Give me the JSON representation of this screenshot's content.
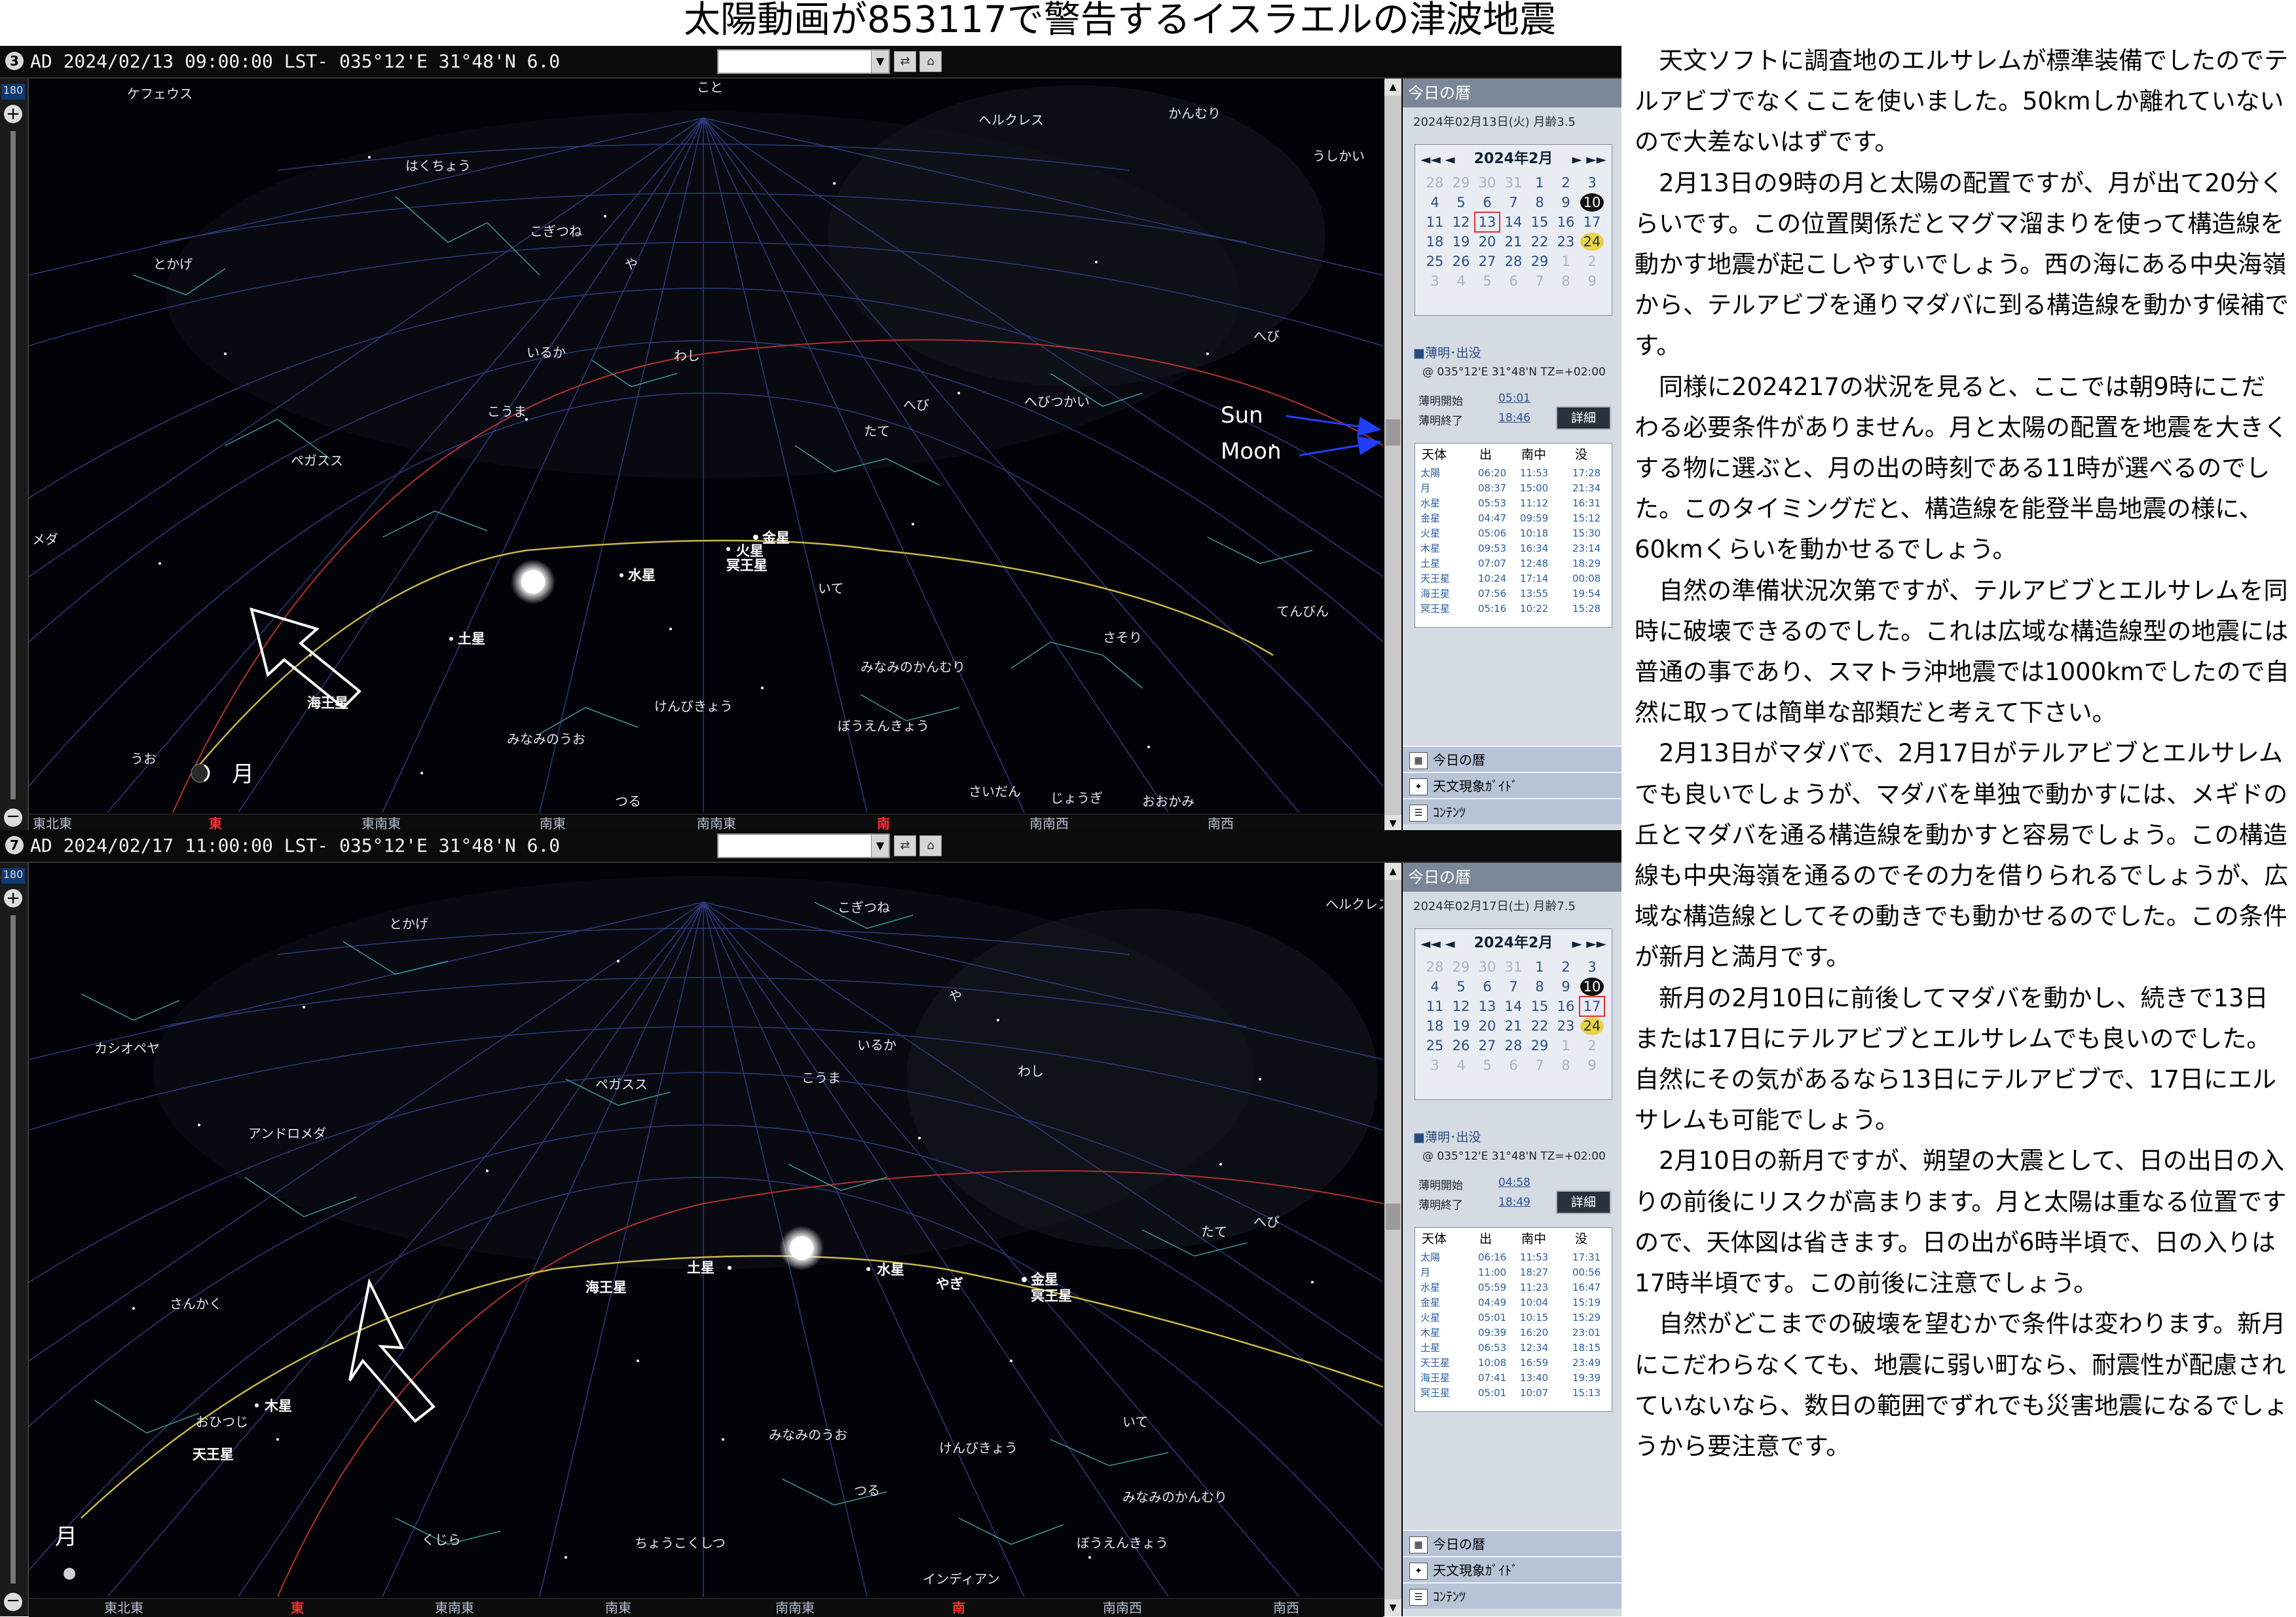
{
  "title": "太陽動画が853117で警告するイスラエルの津波地震",
  "windows": [
    {
      "window_number": "3",
      "status": "AD 2024/02/13 09:00:00 LST- 035°12'E 31°48'N 6.0",
      "slider_value": "180",
      "directions": [
        "東北東",
        "東",
        "東南東",
        "南東",
        "南南東",
        "南",
        "南南西",
        "南西"
      ],
      "main_direction": "東",
      "south": "南",
      "constellations": [
        "ケフェウス",
        "こと",
        "ヘルクレス",
        "かんむり",
        "はくちょう",
        "うしかい",
        "こぎつね",
        "とかげ",
        "や",
        "へび",
        "いるか",
        "わし",
        "へびつかい",
        "こうま",
        "へび",
        "たて",
        "ペガスス",
        "メダ",
        "いて",
        "さそり",
        "てんびん",
        "みなみのかんむり",
        "けんびきょう",
        "ぼうえんきょう",
        "みなみのうお",
        "うお",
        "つる",
        "さいだん",
        "じょうぎ",
        "おおかみ"
      ],
      "planets": [
        "金星",
        "火星",
        "冥王星",
        "水星",
        "土星",
        "海王星",
        "月"
      ],
      "annotations": [
        "Sun",
        "Moon"
      ],
      "today_title": "今日の暦",
      "today_date": "2024年02月13日(火)  月齢3.5",
      "calendar": {
        "month": "2024年2月",
        "nav_left": "◄◄ ◄",
        "nav_right": "► ►►",
        "days": [
          "28",
          "29",
          "30",
          "31",
          "1",
          "2",
          "3",
          "4",
          "5",
          "6",
          "7",
          "8",
          "9",
          "10",
          "11",
          "12",
          "13",
          "14",
          "15",
          "16",
          "17",
          "18",
          "19",
          "20",
          "21",
          "22",
          "23",
          "24",
          "25",
          "26",
          "27",
          "28",
          "29",
          "1",
          "2",
          "3",
          "4",
          "5",
          "6",
          "7",
          "8",
          "9"
        ],
        "selected": "13"
      },
      "twilight_section": "■薄明･出没",
      "location": "@ 035°12'E 31°48'N TZ=+02:00",
      "twilight_start_label": "薄明開始",
      "twilight_start": "05:01",
      "twilight_end_label": "薄明終了",
      "twilight_end": "18:46",
      "detail_button": "詳細",
      "table_headers": [
        "天体",
        "出",
        "南中",
        "没"
      ],
      "table_rows": [
        [
          "太陽",
          "06:20",
          "11:53",
          "17:28"
        ],
        [
          "月",
          "08:37",
          "15:00",
          "21:34"
        ],
        [
          "水星",
          "05:53",
          "11:12",
          "16:31"
        ],
        [
          "金星",
          "04:47",
          "09:59",
          "15:12"
        ],
        [
          "火星",
          "05:06",
          "10:18",
          "15:30"
        ],
        [
          "木星",
          "09:53",
          "16:34",
          "23:14"
        ],
        [
          "土星",
          "07:07",
          "12:48",
          "18:29"
        ],
        [
          "天王星",
          "10:24",
          "17:14",
          "00:08"
        ],
        [
          "海王星",
          "07:56",
          "13:55",
          "19:54"
        ],
        [
          "冥王星",
          "05:16",
          "10:22",
          "15:28"
        ]
      ],
      "buttons": [
        "今日の暦",
        "天文現象ｶﾞｲﾄﾞ",
        "ｺﾝﾃﾝﾂ"
      ]
    },
    {
      "window_number": "7",
      "status": "AD 2024/02/17 11:00:00 LST- 035°12'E 31°48'N 6.0",
      "slider_value": "180",
      "directions": [
        "東北東",
        "東",
        "東南東",
        "南東",
        "南南東",
        "南",
        "南南西",
        "南西"
      ],
      "main_direction": "東",
      "south": "南",
      "constellations": [
        "とかげ",
        "こぎつね",
        "ヘルクレス",
        "や",
        "カシオペヤ",
        "いるか",
        "ペガスス",
        "こうま",
        "わし",
        "アンドロメダ",
        "たて",
        "へび",
        "さんかく",
        "いて",
        "おひつじ",
        "みなみのうお",
        "けんびきょう",
        "つる",
        "みなみのかんむり",
        "くじら",
        "ちょうこくしつ",
        "ぼうえんきょう",
        "インディアン"
      ],
      "planets": [
        "海王星",
        "土星",
        "水星",
        "やぎ",
        "金星",
        "冥王星",
        "木星",
        "天王星",
        "月"
      ],
      "today_title": "今日の暦",
      "today_date": "2024年02月17日(土)  月齢7.5",
      "calendar": {
        "month": "2024年2月",
        "nav_left": "◄◄ ◄",
        "nav_right": "► ►►",
        "days": [
          "28",
          "29",
          "30",
          "31",
          "1",
          "2",
          "3",
          "4",
          "5",
          "6",
          "7",
          "8",
          "9",
          "10",
          "11",
          "12",
          "13",
          "14",
          "15",
          "16",
          "17",
          "18",
          "19",
          "20",
          "21",
          "22",
          "23",
          "24",
          "25",
          "26",
          "27",
          "28",
          "29",
          "1",
          "2",
          "3",
          "4",
          "5",
          "6",
          "7",
          "8",
          "9"
        ],
        "selected": "17"
      },
      "twilight_section": "■薄明･出没",
      "location": "@ 035°12'E 31°48'N TZ=+02:00",
      "twilight_start_label": "薄明開始",
      "twilight_start": "04:58",
      "twilight_end_label": "薄明終了",
      "twilight_end": "18:49",
      "detail_button": "詳細",
      "table_headers": [
        "天体",
        "出",
        "南中",
        "没"
      ],
      "table_rows": [
        [
          "太陽",
          "06:16",
          "11:53",
          "17:31"
        ],
        [
          "月",
          "11:00",
          "18:27",
          "00:56"
        ],
        [
          "水星",
          "05:59",
          "11:23",
          "16:47"
        ],
        [
          "金星",
          "04:49",
          "10:04",
          "15:19"
        ],
        [
          "火星",
          "05:01",
          "10:15",
          "15:29"
        ],
        [
          "木星",
          "09:39",
          "16:20",
          "23:01"
        ],
        [
          "土星",
          "06:53",
          "12:34",
          "18:15"
        ],
        [
          "天王星",
          "10:08",
          "16:59",
          "23:49"
        ],
        [
          "海王星",
          "07:41",
          "13:40",
          "19:39"
        ],
        [
          "冥王星",
          "05:01",
          "10:07",
          "15:13"
        ]
      ],
      "buttons": [
        "今日の暦",
        "天文現象ｶﾞｲﾄﾞ",
        "ｺﾝﾃﾝﾂ"
      ]
    }
  ],
  "paragraphs": [
    "　天文ソフトに調査地のエルサレムが標準装備でしたのでテルアビブでなくここを使いました。50kmしか離れていないので大差ないはずです。",
    "　2月13日の9時の月と太陽の配置ですが、月が出て20分くらいです。この位置関係だとマグマ溜まりを使って構造線を動かす地震が起こしやすいでしょう。西の海にある中央海嶺から、テルアビブを通りマダバに到る構造線を動かす候補です。",
    "　同様に2024217の状況を見ると、ここでは朝9時にこだわる必要条件がありません。月と太陽の配置を地震を大きくする物に選ぶと、月の出の時刻である11時が選べるのでした。このタイミングだと、構造線を能登半島地震の様に、60kmくらいを動かせるでしょう。",
    "　自然の準備状況次第ですが、テルアビブとエルサレムを同時に破壊できるのでした。これは広域な構造線型の地震には普通の事であり、スマトラ沖地震では1000kmでしたので自然に取っては簡単な部類だと考えて下さい。",
    "　2月13日がマダバで、2月17日がテルアビブとエルサレムでも良いでしょうが、マダバを単独で動かすには、メギドの丘とマダバを通る構造線を動かすと容易でしょう。この構造線も中央海嶺を通るのでその力を借りられるでしょうが、広域な構造線としてその動きでも動かせるのでした。この条件が新月と満月です。",
    "　新月の2月10日に前後してマダバを動かし、続きで13日または17日にテルアビブとエルサレムでも良いのでした。自然にその気があるなら13日にテルアビブで、17日にエルサレムも可能でしょう。",
    "　2月10日の新月ですが、朔望の大震として、日の出日の入りの前後にリスクが高まります。月と太陽は重なる位置ですので、天体図は省きます。日の出が6時半頃で、日の入りは17時半頃です。この前後に注意でしょう。",
    "　自然がどこまでの破壊を望むかで条件は変わります。新月にこだわらなくても、地震に弱い町なら、耐震性が配慮されていないなら、数日の範囲でずれでも災害地震になるでしょうから要注意です。"
  ],
  "colors": {
    "sky": "#000000",
    "grid": "#2f3f8a",
    "ecliptic": "#c9b64a",
    "horizon_arc": "#b03030",
    "constellation_line": "#3fa7a7",
    "label": "#dfe6ee",
    "panel": "#d5dbe3",
    "annotation_arrow": "#1f3fff"
  }
}
